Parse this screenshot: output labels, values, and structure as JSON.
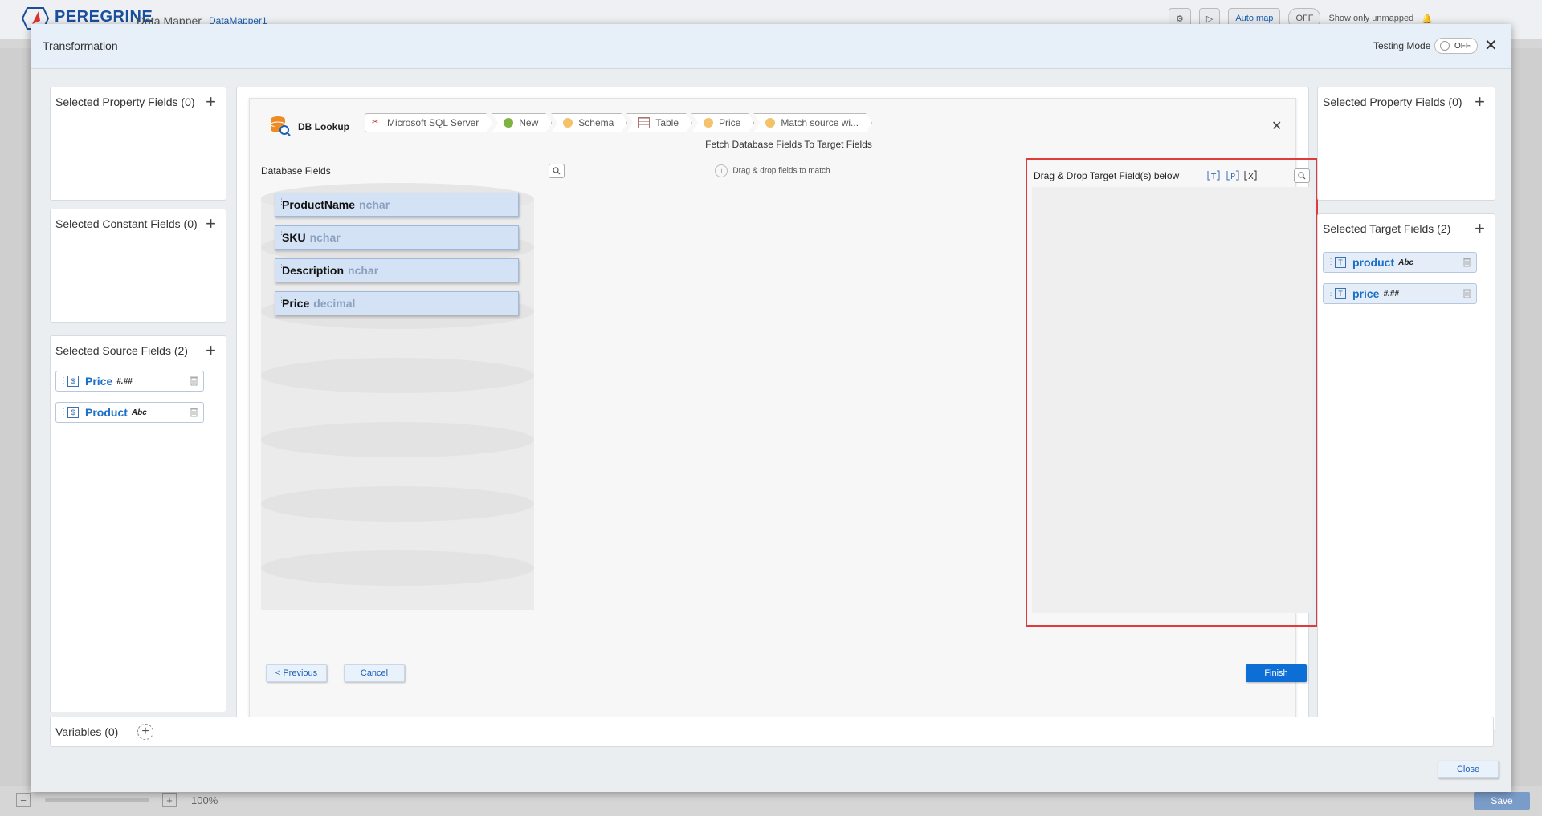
{
  "app": {
    "logo_text": "PEREGRINE",
    "app_name": "Data Mapper",
    "map_name": "DataMapper1",
    "auto_map": "Auto map",
    "toggle_off": "OFF",
    "show_unmapped": "Show only unmapped",
    "zoom": "100%",
    "save": "Save"
  },
  "modal": {
    "title": "Transformation",
    "testing_mode_label": "Testing Mode",
    "testing_mode_state": "OFF",
    "close_label": "Close"
  },
  "left": {
    "property": {
      "title": "Selected Property Fields (0)"
    },
    "constant": {
      "title": "Selected Constant Fields (0)"
    },
    "source": {
      "title": "Selected Source Fields (2)",
      "items": [
        {
          "name": "Price",
          "type": "#.##"
        },
        {
          "name": "Product",
          "type": "Abc"
        }
      ]
    }
  },
  "right": {
    "property": {
      "title": "Selected Property Fields (0)"
    },
    "target": {
      "title": "Selected Target Fields (2)",
      "items": [
        {
          "name": "product",
          "type": "Abc"
        },
        {
          "name": "price",
          "type": "#.##"
        }
      ]
    }
  },
  "wizard": {
    "title": "DB Lookup",
    "breadcrumb": [
      "Microsoft SQL Server",
      "New",
      "Schema",
      "Table",
      "Price",
      "Match source wi..."
    ],
    "subtitle": "Fetch Database Fields To Target Fields",
    "db_fields_label": "Database Fields",
    "db_fields": [
      {
        "name": "ProductName",
        "type": "nchar"
      },
      {
        "name": "SKU",
        "type": "nchar"
      },
      {
        "name": "Description",
        "type": "nchar"
      },
      {
        "name": "Price",
        "type": "decimal"
      }
    ],
    "hint": "Drag & drop fields to match",
    "target_label": "Drag & Drop Target Field(s) below",
    "previous": "< Previous",
    "cancel": "Cancel",
    "finish": "Finish"
  },
  "variables": {
    "title": "Variables (0)"
  },
  "colors": {
    "accent": "#0d6ed6",
    "highlight": "#e03b3b",
    "field_chip": "#d4e2f6"
  }
}
